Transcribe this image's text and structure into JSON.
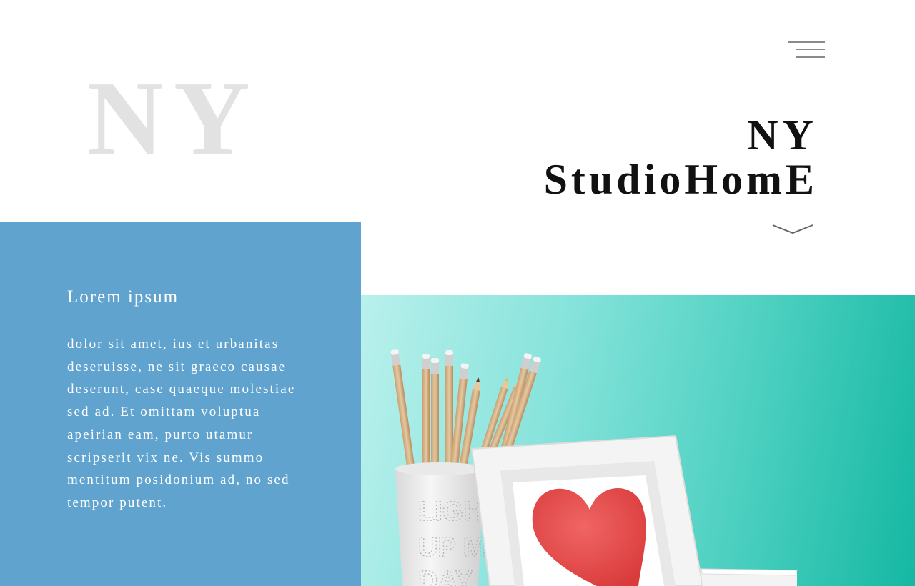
{
  "brand": {
    "background_letters": "NY",
    "title_line1": "NY",
    "title_line2": "StudioHomE"
  },
  "navigation": {
    "menu_icon": "hamburger-menu-icon",
    "scroll_icon": "chevron-down-icon"
  },
  "intro": {
    "heading": "Lorem ipsum",
    "body": "dolor sit amet, ius et urbanitas deseruisse, ne sit graeco causae deserunt, case quaeque molestiae sed ad. Et omittam voluptua apeirian eam, purto utamur scripserit vix ne. Vis summo mentitum posidonium ad, no sed tempor putent."
  },
  "photo": {
    "cup_text": [
      "LIGHT",
      "UP M",
      "DAY"
    ]
  },
  "colors": {
    "panel_blue": "#61a3cf",
    "teal": "#2cc4b1",
    "heart_red": "#e84a4a",
    "title_text": "#111111",
    "faint_letters": "#e2e2e2"
  }
}
